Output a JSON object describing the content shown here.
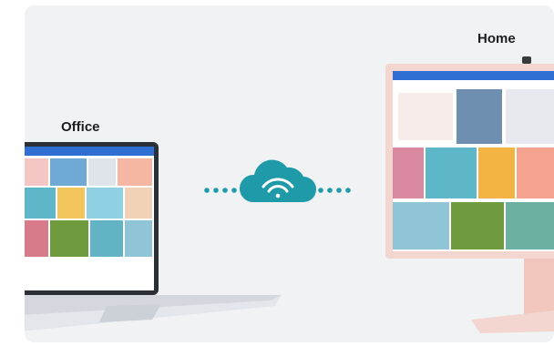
{
  "labels": {
    "office": "Office",
    "home": "Home"
  },
  "icons": {
    "connection": "wifi-cloud-icon",
    "dots": "dotted-line"
  },
  "colors": {
    "background": "#f1f2f4",
    "cloud": "#1f9aa8",
    "dots": "#1f9aa8",
    "laptop_body": "#e3e6ea",
    "monitor_frame": "#f2d6cf",
    "monitor_stand": "#f1c7bd"
  }
}
